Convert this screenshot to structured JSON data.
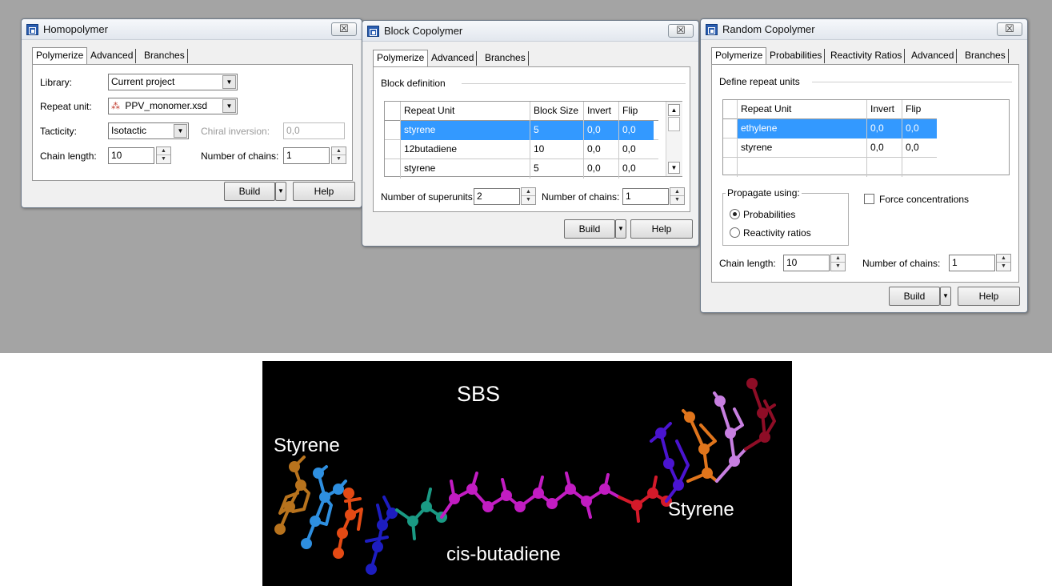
{
  "homopolymer": {
    "title": "Homopolymer",
    "close": "☒",
    "tabs": [
      "Polymerize",
      "Advanced",
      "Branches"
    ],
    "library_label": "Library:",
    "library_value": "Current project",
    "repeat_label": "Repeat unit:",
    "repeat_value": "PPV_monomer.xsd",
    "tacticity_label": "Tacticity:",
    "tacticity_value": "Isotactic",
    "chiral_label": "Chiral inversion:",
    "chiral_value": "0,0",
    "chain_label": "Chain length:",
    "chain_value": "10",
    "chains_label": "Number of chains:",
    "chains_value": "1",
    "build": "Build",
    "help": "Help"
  },
  "block": {
    "title": "Block Copolymer",
    "close": "☒",
    "tabs": [
      "Polymerize",
      "Advanced",
      "Branches"
    ],
    "group": "Block definition",
    "headers": [
      "Repeat Unit",
      "Block Size",
      "Invert",
      "Flip"
    ],
    "rows": [
      {
        "unit": "styrene",
        "size": "5",
        "invert": "0,0",
        "flip": "0,0",
        "selected": true
      },
      {
        "unit": "12butadiene",
        "size": "10",
        "invert": "0,0",
        "flip": "0,0"
      },
      {
        "unit": "styrene",
        "size": "5",
        "invert": "0,0",
        "flip": "0,0"
      }
    ],
    "superunits_label": "Number of superunits:",
    "superunits_value": "2",
    "chains_label": "Number of chains:",
    "chains_value": "1",
    "build": "Build",
    "help": "Help"
  },
  "random": {
    "title": "Random Copolymer",
    "close": "☒",
    "tabs": [
      "Polymerize",
      "Probabilities",
      "Reactivity Ratios",
      "Advanced",
      "Branches"
    ],
    "group": "Define repeat units",
    "headers": [
      "Repeat Unit",
      "Invert",
      "Flip"
    ],
    "rows": [
      {
        "unit": "ethylene",
        "invert": "0,0",
        "flip": "0,0",
        "selected": true
      },
      {
        "unit": "styrene",
        "invert": "0,0",
        "flip": "0,0"
      }
    ],
    "propagate_label": "Propagate using:",
    "opt_prob": "Probabilities",
    "opt_react": "Reactivity ratios",
    "force_label": "Force concentrations",
    "chain_label": "Chain length:",
    "chain_value": "10",
    "chains_label": "Number of chains:",
    "chains_value": "1",
    "build": "Build",
    "help": "Help"
  },
  "scene": {
    "title": "SBS",
    "label_left": "Styrene",
    "label_right": "Styrene",
    "label_center": "cis-butadiene"
  }
}
